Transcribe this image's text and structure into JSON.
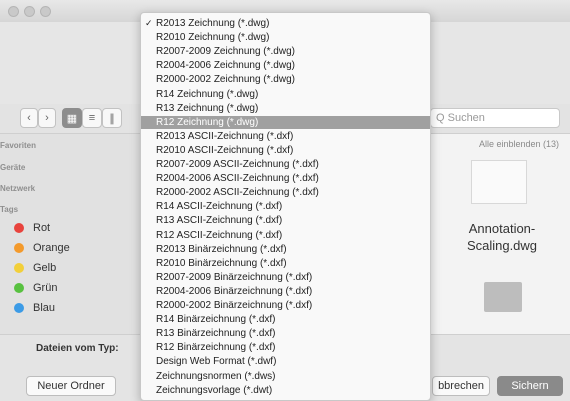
{
  "sidebar": {
    "favorites": "Favoriten",
    "devices": "Geräte",
    "network": "Netzwerk",
    "tags": "Tags",
    "tag_items": [
      {
        "label": "Rot",
        "color": "#e8433d"
      },
      {
        "label": "Orange",
        "color": "#f39a2c"
      },
      {
        "label": "Gelb",
        "color": "#f2cf3a"
      },
      {
        "label": "Grün",
        "color": "#58c140"
      },
      {
        "label": "Blau",
        "color": "#3c9be6"
      }
    ]
  },
  "toolbar": {
    "search_placeholder": "Q Suchen"
  },
  "files": {
    "show_all": "Alle einblenden (13)",
    "file_name_line1": "Annotation-",
    "file_name_line2": "Scaling.dwg"
  },
  "bottom": {
    "format_label": "Dateien vom Typ:",
    "new_folder": "Neuer Ordner",
    "cancel": "bbrechen",
    "save": "Sichern"
  },
  "menu": {
    "selected_index": 0,
    "highlighted_index": 7,
    "items": [
      "R2013 Zeichnung (*.dwg)",
      "R2010 Zeichnung (*.dwg)",
      "R2007-2009 Zeichnung (*.dwg)",
      "R2004-2006 Zeichnung (*.dwg)",
      "R2000-2002 Zeichnung (*.dwg)",
      "R14 Zeichnung (*.dwg)",
      "R13 Zeichnung (*.dwg)",
      "R12 Zeichnung (*.dwg)",
      "R2013 ASCII-Zeichnung (*.dxf)",
      "R2010 ASCII-Zeichnung (*.dxf)",
      "R2007-2009 ASCII-Zeichnung (*.dxf)",
      "R2004-2006 ASCII-Zeichnung (*.dxf)",
      "R2000-2002 ASCII-Zeichnung (*.dxf)",
      "R14 ASCII-Zeichnung (*.dxf)",
      "R13 ASCII-Zeichnung (*.dxf)",
      "R12 ASCII-Zeichnung (*.dxf)",
      "R2013 Binärzeichnung (*.dxf)",
      "R2010 Binärzeichnung (*.dxf)",
      "R2007-2009 Binärzeichnung (*.dxf)",
      "R2004-2006 Binärzeichnung (*.dxf)",
      "R2000-2002 Binärzeichnung (*.dxf)",
      "R14 Binärzeichnung (*.dxf)",
      "R13 Binärzeichnung (*.dxf)",
      "R12 Binärzeichnung (*.dxf)",
      "Design Web Format (*.dwf)",
      "Zeichnungsnormen (*.dws)",
      "Zeichnungsvorlage (*.dwt)"
    ]
  }
}
